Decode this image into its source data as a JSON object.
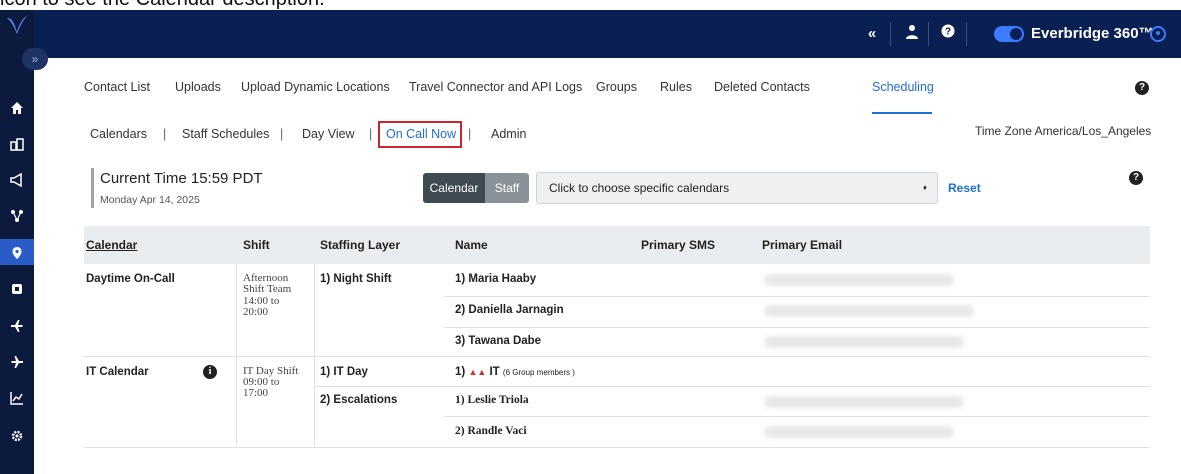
{
  "instruction_text": "icon to see the Calendar description.",
  "topbar": {
    "icons": [
      "chevrons-left-icon",
      "user-icon",
      "help-icon"
    ],
    "brand": "Everbridge 360™"
  },
  "sidebar": {
    "collapse_label": "»",
    "items": [
      "home-icon",
      "buildings-icon",
      "megaphone-icon",
      "network-icon",
      "location-pin-icon",
      "stop-icon",
      "plane-icon",
      "plane-icon",
      "chart-icon",
      "gear-icon"
    ]
  },
  "nav1": {
    "items": [
      "Contact List",
      "Uploads",
      "Upload Dynamic Locations",
      "Travel Connector and API Logs",
      "Groups",
      "Rules",
      "Deleted Contacts",
      "Scheduling"
    ],
    "active": "Scheduling"
  },
  "nav2": {
    "items": [
      "Calendars",
      "Staff Schedules",
      "Day View",
      "On Call Now",
      "Admin"
    ],
    "separator": "|",
    "active": "On Call Now"
  },
  "timezone": "Time Zone America/Los_Angeles",
  "current": {
    "time": "Current Time  15:59 PDT",
    "date": "Monday Apr 14, 2025"
  },
  "toggle": {
    "calendar": "Calendar",
    "staff": "Staff"
  },
  "calendar_select": {
    "placeholder": "Click to choose specific calendars",
    "caret": "♦"
  },
  "reset_label": "Reset",
  "table": {
    "headers": [
      "Calendar",
      "Shift",
      "Staffing Layer",
      "Name",
      "Primary SMS",
      "Primary Email"
    ],
    "groups": [
      {
        "calendar": "Daytime On-Call",
        "shift_name": "Afternoon Shift Team",
        "shift_time": "14:00 to 20:00",
        "layers": [
          {
            "layer": "1) Night Shift",
            "names": [
              "1) Maria Haaby",
              "2) Daniella Jarnagin",
              "3) Tawana Dabe"
            ]
          }
        ]
      },
      {
        "calendar": "IT Calendar",
        "shift_name": "IT Day Shift",
        "shift_time": "09:00 to 17:00",
        "layers": [
          {
            "layer": "1) IT Day",
            "names": [
              "1)",
              "IT",
              "(6 Group members )"
            ]
          },
          {
            "layer": "2) Escalations",
            "names": [
              "1) Leslie Triola",
              "2) Randle Vaci"
            ]
          }
        ]
      }
    ]
  }
}
